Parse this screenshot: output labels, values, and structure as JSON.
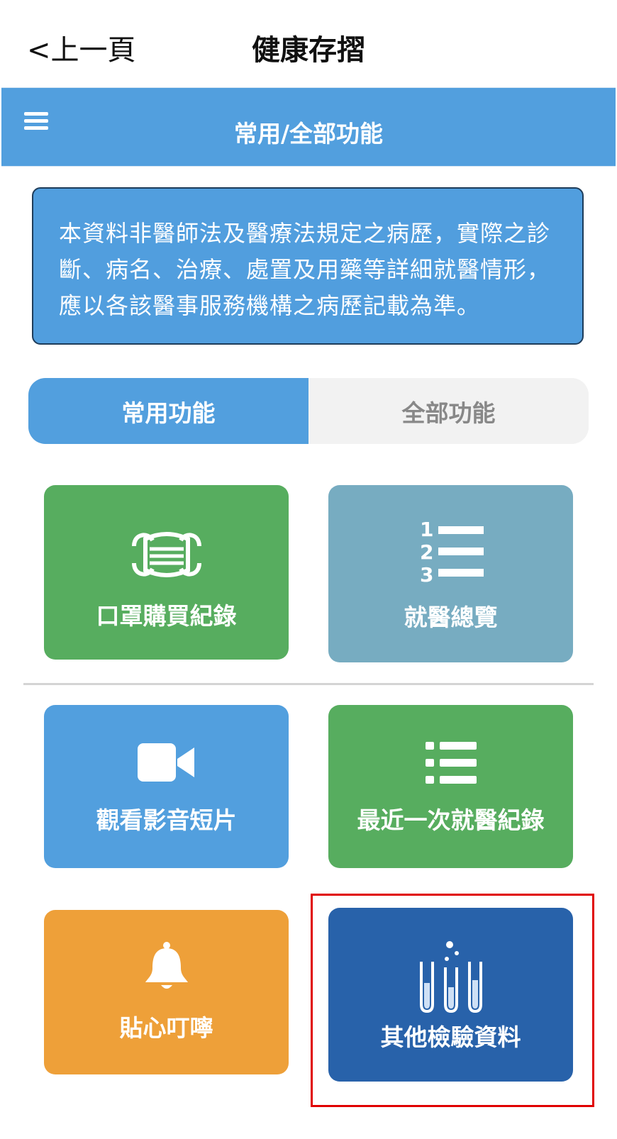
{
  "header": {
    "back_label": "<上一頁",
    "title": "健康存摺"
  },
  "navbar": {
    "title": "常用/全部功能"
  },
  "notice": {
    "text": "本資料非醫師法及醫療法規定之病歷，實際之診斷、病名、治療、處置及用藥等詳細就醫情形，應以各該醫事服務機構之病歷記載為準。"
  },
  "tabs": [
    {
      "label": "常用功能",
      "active": true
    },
    {
      "label": "全部功能",
      "active": false
    }
  ],
  "tiles": [
    {
      "label": "口罩購買紀錄",
      "icon": "mask-icon",
      "color": "#57ad5f"
    },
    {
      "label": "就醫總覽",
      "icon": "numbered-list-icon",
      "color": "#77acc1"
    },
    {
      "label": "觀看影音短片",
      "icon": "video-camera-icon",
      "color": "#529fde"
    },
    {
      "label": "最近一次就醫紀錄",
      "icon": "list-icon",
      "color": "#57ad5f"
    },
    {
      "label": "貼心叮嚀",
      "icon": "bell-icon",
      "color": "#eea039"
    },
    {
      "label": "其他檢驗資料",
      "icon": "test-tubes-icon",
      "color": "#2862aa"
    }
  ]
}
